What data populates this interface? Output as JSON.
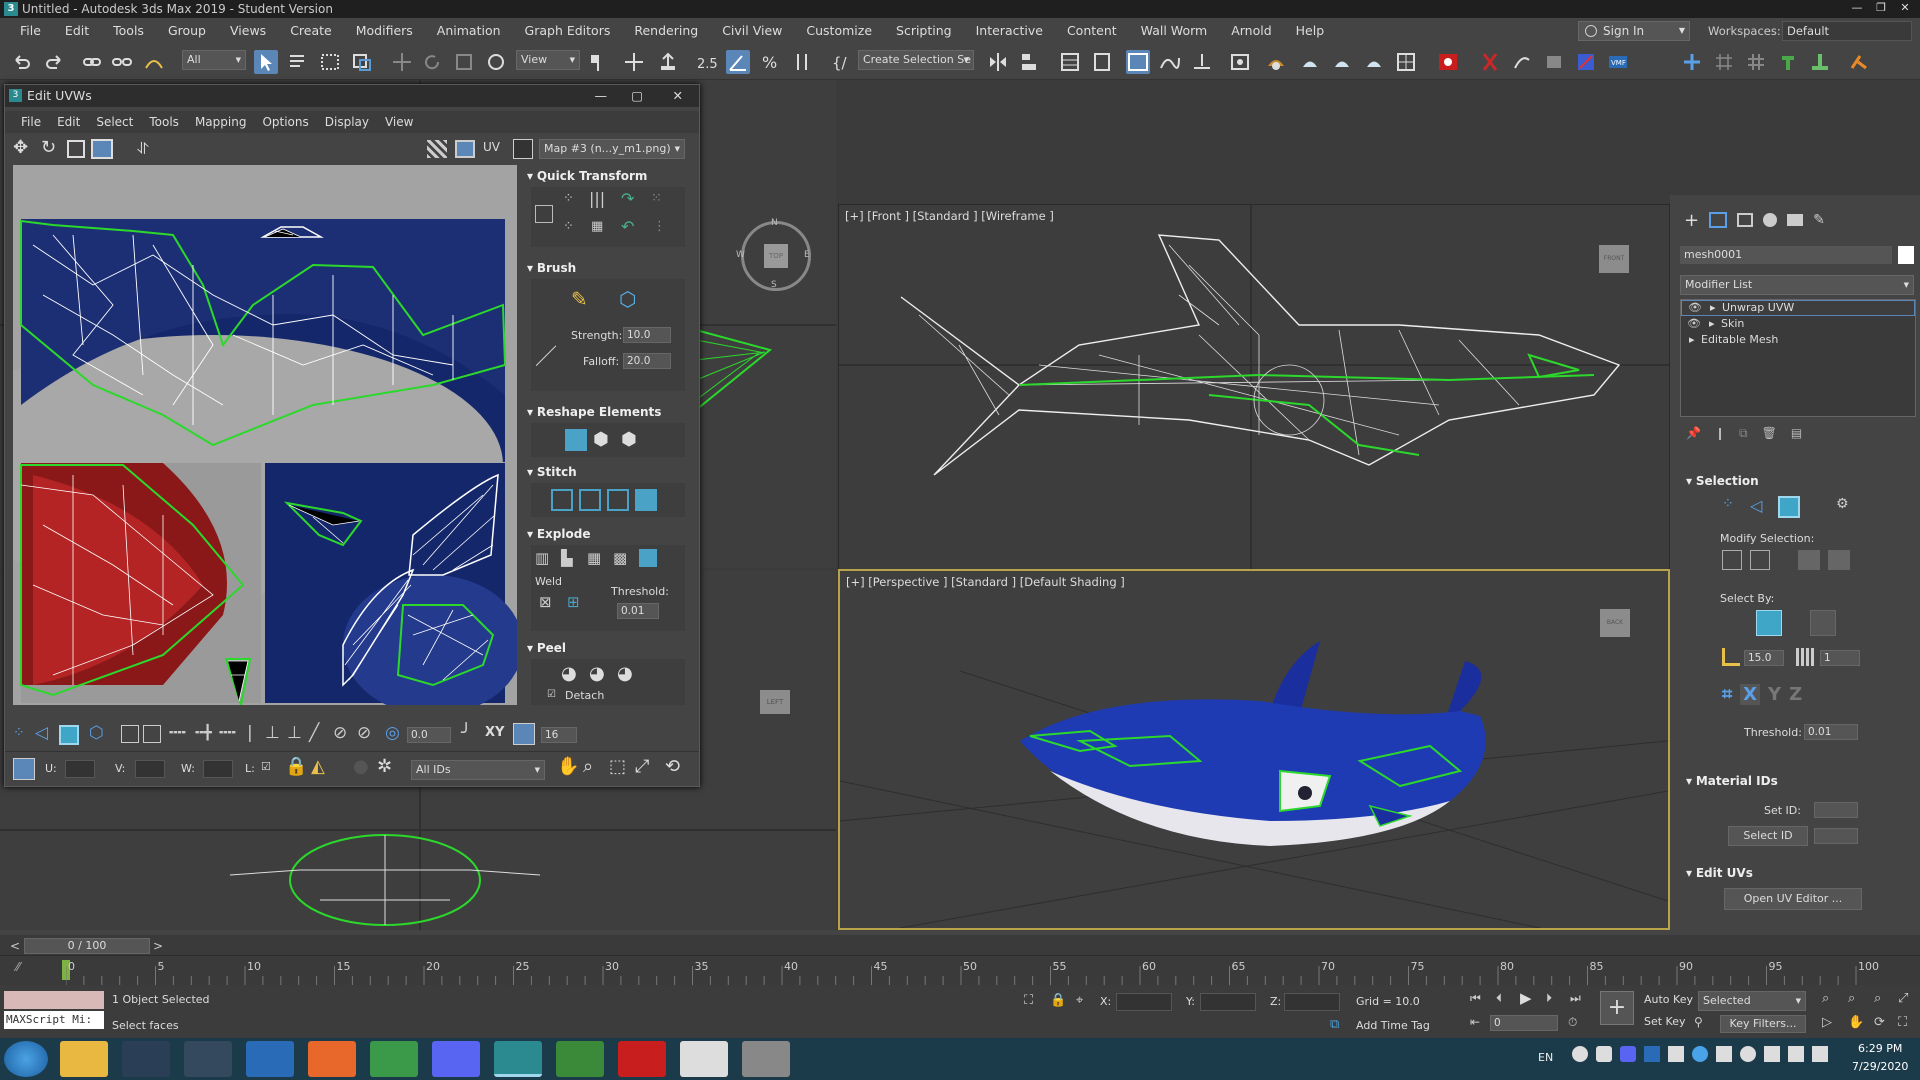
{
  "window": {
    "title": "Untitled - Autodesk 3ds Max 2019 - Student Version",
    "app_icon": "3"
  },
  "menubar": {
    "items": [
      "File",
      "Edit",
      "Tools",
      "Group",
      "Views",
      "Create",
      "Modifiers",
      "Animation",
      "Graph Editors",
      "Rendering",
      "Civil View",
      "Customize",
      "Scripting",
      "Interactive",
      "Content",
      "Wall Worm",
      "Arnold",
      "Help"
    ],
    "sign_in": "Sign In",
    "workspaces_label": "Workspaces:",
    "workspace_value": "Default"
  },
  "toolbar": {
    "filter": "All",
    "ref_coord": "View",
    "selection_set": "Create Selection Se"
  },
  "edit_uvws": {
    "title": "Edit UVWs",
    "menu": [
      "File",
      "Edit",
      "Select",
      "Tools",
      "Mapping",
      "Options",
      "Display",
      "View"
    ],
    "uv_label": "UV",
    "map_dropdown": "Map #3 (n...y_m1.png)",
    "rollouts": {
      "quick_transform": "Quick Transform",
      "brush": "Brush",
      "strength_label": "Strength:",
      "strength_value": "10.0",
      "falloff_label": "Falloff:",
      "falloff_value": "20.0",
      "reshape": "Reshape Elements",
      "stitch": "Stitch",
      "explode": "Explode",
      "weld": "Weld",
      "threshold_label": "Threshold:",
      "threshold_value": "0.01",
      "peel": "Peel",
      "detach": "Detach"
    },
    "bottom": {
      "rotate_value": "0.0",
      "xy": "XY",
      "grid_value": "16",
      "u_label": "U:",
      "v_label": "V:",
      "w_label": "W:",
      "l_label": "L:",
      "ids": "All IDs"
    }
  },
  "viewports": {
    "front": "[+] [Front ] [Standard ] [Wireframe ]",
    "perspective": "[+] [Perspective ] [Standard ] [Default Shading ]",
    "viewcube_top": "TOP",
    "viewcube_front": "FRONT",
    "viewcube_left": "LEFT",
    "viewcube_back": "BACK",
    "compass": {
      "n": "N",
      "s": "S",
      "e": "E",
      "w": "W"
    }
  },
  "command_panel": {
    "object_name": "mesh0001",
    "modifier_list": "Modifier List",
    "stack": [
      "Unwrap UVW",
      "Skin",
      "Editable Mesh"
    ],
    "selection": "Selection",
    "modify_selection": "Modify Selection:",
    "select_by": "Select By:",
    "angle_value": "15.0",
    "count_value": "1",
    "threshold_label": "Threshold:",
    "threshold_value": "0.01",
    "material_ids": "Material IDs",
    "set_id_label": "Set ID:",
    "select_id_label": "Select ID",
    "edit_uvs": "Edit UVs",
    "open_uv_editor": "Open UV Editor ..."
  },
  "timeline": {
    "frame": "0 / 100",
    "ticks": [
      "0",
      "5",
      "10",
      "15",
      "20",
      "25",
      "30",
      "35",
      "40",
      "45",
      "50",
      "55",
      "60",
      "65",
      "70",
      "75",
      "80",
      "85",
      "90",
      "95",
      "100"
    ]
  },
  "status": {
    "maxscript": "MAXScript Mi:",
    "selected": "1 Object Selected",
    "prompt": "Select faces",
    "x_label": "X:",
    "y_label": "Y:",
    "z_label": "Z:",
    "grid": "Grid = 10.0",
    "add_time_tag": "Add Time Tag",
    "auto_key": "Auto Key",
    "set_key": "Set Key",
    "selected_dd": "Selected",
    "key_filters": "Key Filters...",
    "frame_value": "0"
  },
  "taskbar": {
    "lang": "EN",
    "time": "6:29 PM",
    "date": "7/29/2020"
  }
}
